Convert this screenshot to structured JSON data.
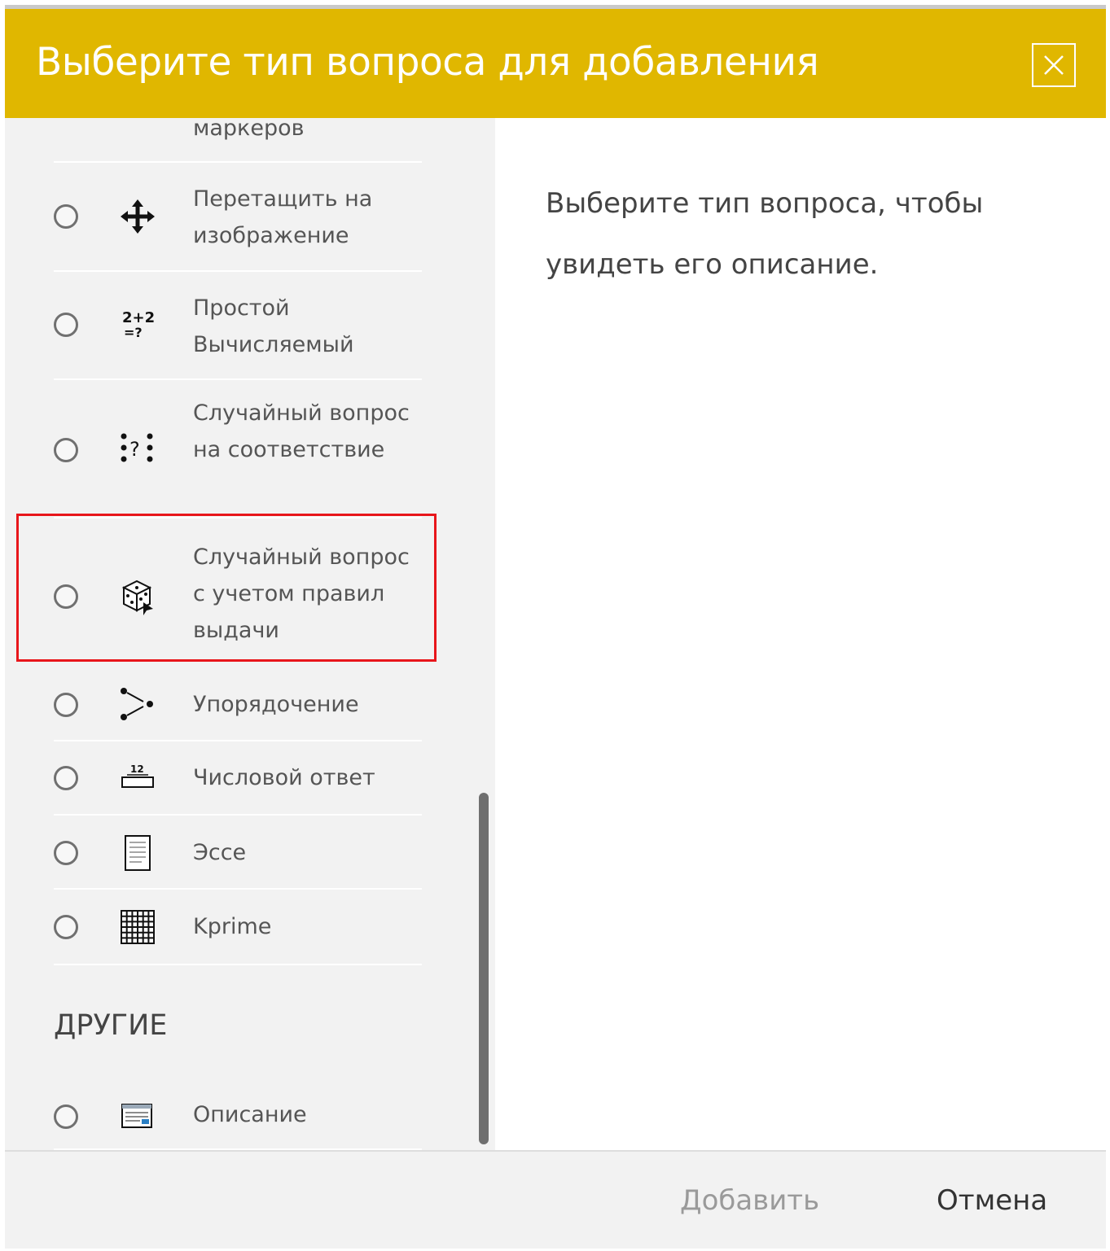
{
  "dialog": {
    "title": "Выберите тип вопроса для добавления",
    "close_icon": "close-icon",
    "accent_color": "#e0b700"
  },
  "list": {
    "partial_item_label": "маркеров",
    "items": [
      {
        "label": "Перетащить на изображение",
        "icon": "move-arrows-icon"
      },
      {
        "label": "Простой Вычисляемый",
        "icon": "calculated-icon"
      },
      {
        "label": "Случайный вопрос на соответствие",
        "icon": "random-match-icon"
      },
      {
        "label": "Случайный вопрос с учетом правил выдачи",
        "icon": "dice-icon",
        "highlighted": true
      },
      {
        "label": "Упорядочение",
        "icon": "ordering-icon"
      },
      {
        "label": "Числовой ответ",
        "icon": "numerical-icon"
      },
      {
        "label": "Эссе",
        "icon": "essay-icon"
      },
      {
        "label": "Kprime",
        "icon": "grid-icon"
      }
    ],
    "section_other": "ДРУГИЕ",
    "other_items": [
      {
        "label": "Описание",
        "icon": "description-icon"
      }
    ]
  },
  "description": {
    "text": "Выберите тип вопроса, чтобы увидеть его описание."
  },
  "footer": {
    "add_label": "Добавить",
    "cancel_label": "Отмена"
  }
}
